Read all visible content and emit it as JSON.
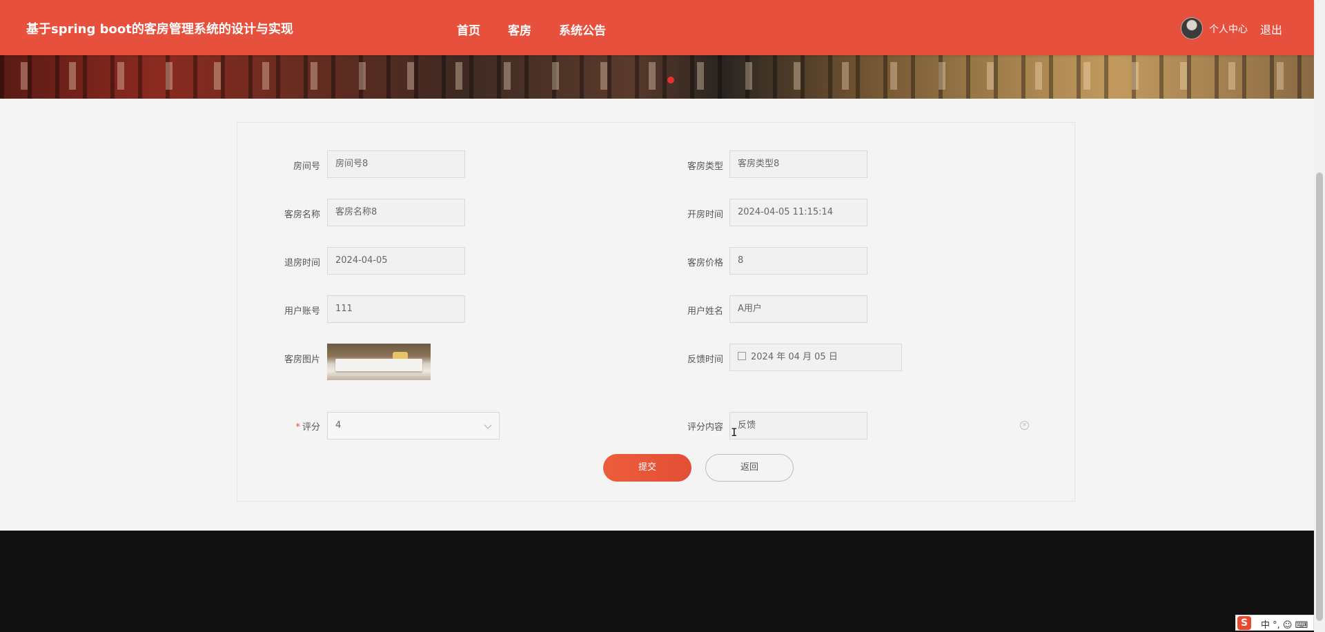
{
  "header": {
    "site_title": "基于spring boot的客房管理系统的设计与实现",
    "nav": [
      "首页",
      "客房",
      "系统公告"
    ],
    "user_center": "个人中心",
    "logout": "退出"
  },
  "form": {
    "room_number": {
      "label": "房间号",
      "value": "房间号8"
    },
    "room_type": {
      "label": "客房类型",
      "value": "客房类型8"
    },
    "room_name": {
      "label": "客房名称",
      "value": "客房名称8"
    },
    "checkin_time": {
      "label": "开房时间",
      "value": "2024-04-05 11:15:14"
    },
    "checkout_time": {
      "label": "退房时间",
      "value": "2024-04-05"
    },
    "room_price": {
      "label": "客房价格",
      "value": "8"
    },
    "user_account": {
      "label": "用户账号",
      "value": "111"
    },
    "user_name": {
      "label": "用户姓名",
      "value": "A用户"
    },
    "room_image": {
      "label": "客房图片"
    },
    "feedback_time": {
      "label": "反馈时间",
      "value": "2024 年 04 月 05 日"
    },
    "rating": {
      "required_mark": "*",
      "label": "评分",
      "value": "4"
    },
    "comment": {
      "label": "评分内容",
      "value": "反馈"
    }
  },
  "buttons": {
    "submit": "提交",
    "back": "返回"
  },
  "ime": {
    "logo": "S",
    "text": "中 °, ☺ ⌨"
  },
  "colors": {
    "primary": "#e6503c",
    "footer": "#111111"
  }
}
